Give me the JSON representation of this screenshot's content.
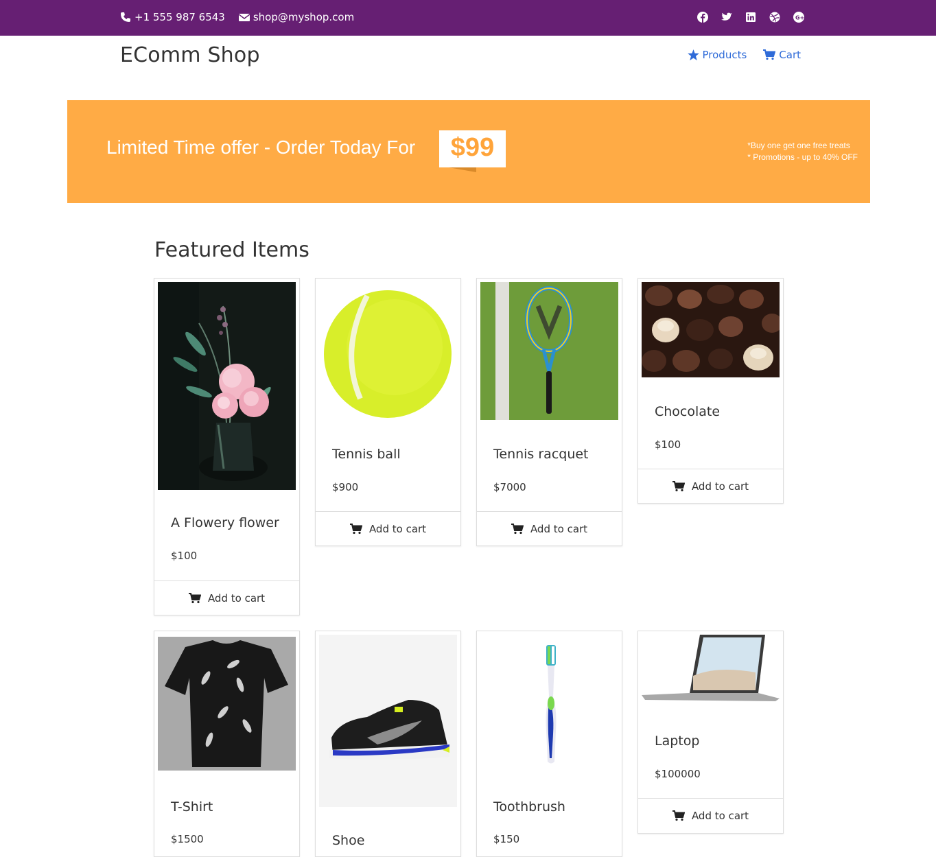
{
  "topbar": {
    "phone": "+1 555 987 6543",
    "email": "shop@myshop.com",
    "social_icons": [
      "facebook-icon",
      "twitter-icon",
      "linkedin-icon",
      "dribbble-icon",
      "google-plus-icon"
    ]
  },
  "header": {
    "brand": "EComm Shop",
    "nav": [
      {
        "label": "Products",
        "icon": "star-icon"
      },
      {
        "label": "Cart",
        "icon": "cart-icon"
      }
    ]
  },
  "banner": {
    "headline": "Limited Time offer - Order Today For",
    "price": "$99",
    "promo_1": "*Buy one get one free treats",
    "promo_2": "* Promotions - up to 40% OFF"
  },
  "featured": {
    "title": "Featured Items",
    "add_to_cart_label": "Add to cart",
    "items": [
      {
        "name": "A Flowery flower",
        "price": "$100"
      },
      {
        "name": "Tennis ball",
        "price": "$900"
      },
      {
        "name": "Tennis racquet",
        "price": "$7000"
      },
      {
        "name": "Chocolate",
        "price": "$100"
      },
      {
        "name": "T-Shirt",
        "price": "$1500"
      },
      {
        "name": "Shoe",
        "price": ""
      },
      {
        "name": "Toothbrush",
        "price": "$150"
      },
      {
        "name": "Laptop",
        "price": "$100000"
      }
    ]
  },
  "colors": {
    "topbar": "#661f73",
    "banner": "#ffab45",
    "link": "#2f6bd8"
  }
}
